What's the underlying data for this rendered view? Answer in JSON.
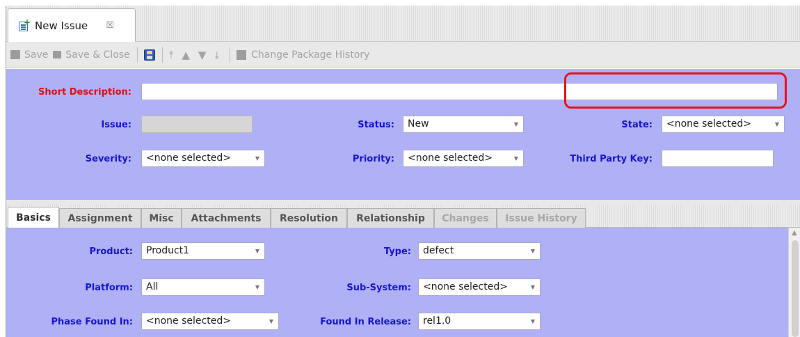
{
  "doc_tab": {
    "title": "New Issue",
    "close_glyph": "☒"
  },
  "toolbar": {
    "save": "Save",
    "save_close": "Save & Close",
    "change_package_history": "Change Package History"
  },
  "header": {
    "short_description_label": "Short Description:",
    "short_description_value": "",
    "issue_label": "Issue:",
    "status_label": "Status:",
    "status_value": "New",
    "state_label": "State:",
    "state_value": "<none selected>",
    "severity_label": "Severity:",
    "severity_value": "<none selected>",
    "priority_label": "Priority:",
    "priority_value": "<none selected>",
    "third_party_key_label": "Third Party Key:",
    "third_party_key_value": ""
  },
  "tabs": [
    "Basics",
    "Assignment",
    "Misc",
    "Attachments",
    "Resolution",
    "Relationship",
    "Changes",
    "Issue History"
  ],
  "basics": {
    "product_label": "Product:",
    "product_value": "Product1",
    "type_label": "Type:",
    "type_value": "defect",
    "platform_label": "Platform:",
    "platform_value": "All",
    "subsystem_label": "Sub-System:",
    "subsystem_value": "<none selected>",
    "phase_found_label": "Phase Found In:",
    "phase_found_value": "<none selected>",
    "found_release_label": "Found In Release:",
    "found_release_value": "rel1.0"
  },
  "colors": {
    "panel": "#b0b0f7",
    "label": "#1515d0",
    "required_label": "#e01010",
    "highlight": "#e8121b"
  }
}
